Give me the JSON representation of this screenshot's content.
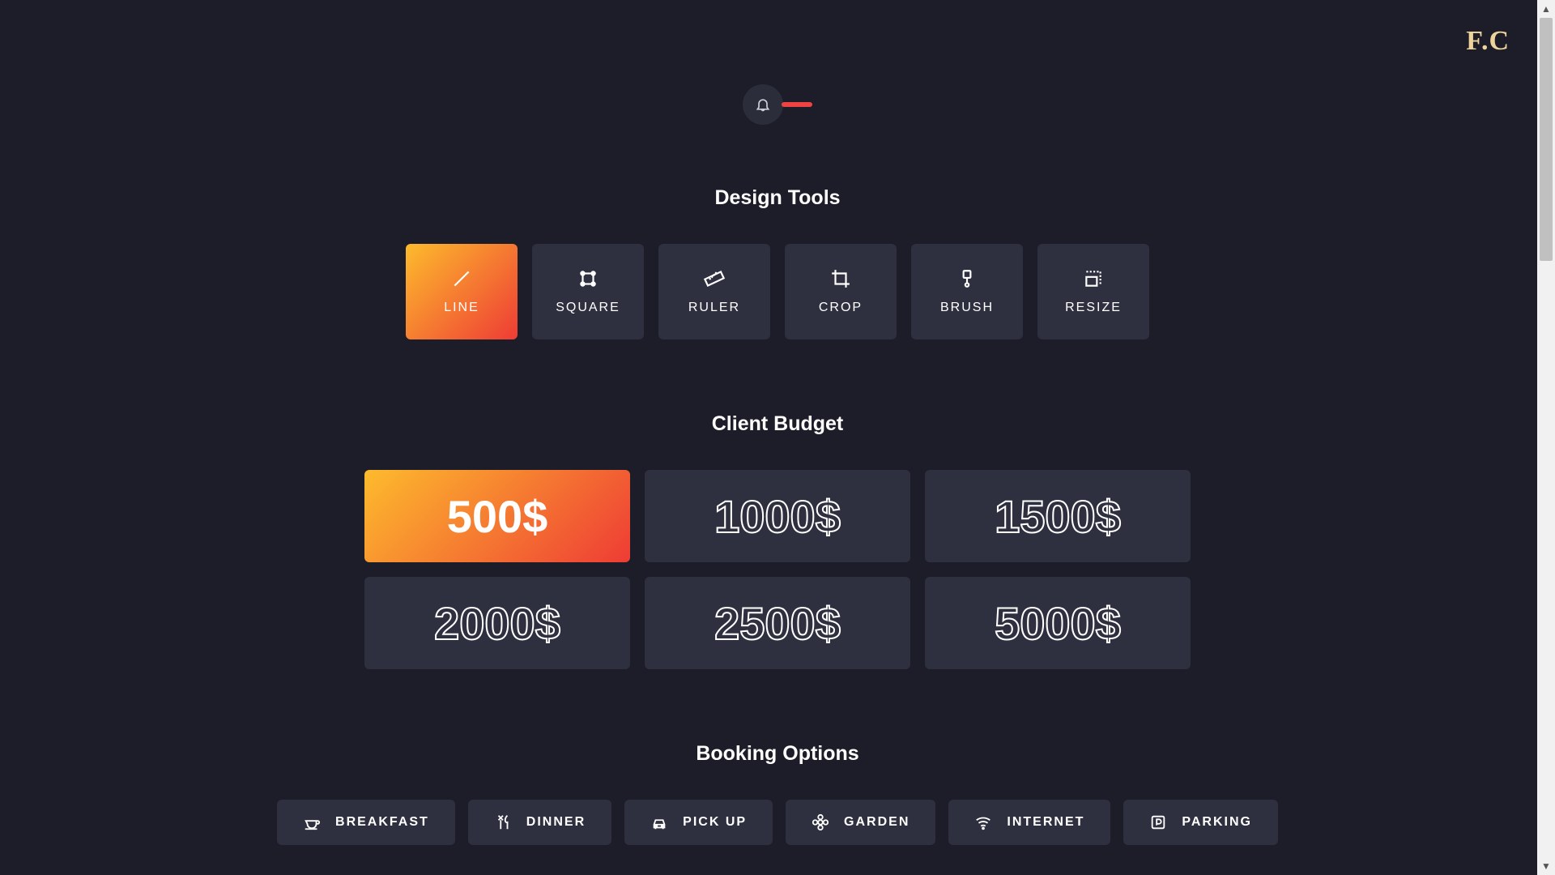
{
  "logo": "F.C",
  "sections": {
    "tools_title": "Design Tools",
    "budget_title": "Client Budget",
    "booking_title": "Booking Options"
  },
  "tools": [
    {
      "label": "LINE",
      "icon": "line-icon",
      "active": true
    },
    {
      "label": "SQUARE",
      "icon": "square-icon",
      "active": false
    },
    {
      "label": "RULER",
      "icon": "ruler-icon",
      "active": false
    },
    {
      "label": "CROP",
      "icon": "crop-icon",
      "active": false
    },
    {
      "label": "BRUSH",
      "icon": "brush-icon",
      "active": false
    },
    {
      "label": "RESIZE",
      "icon": "resize-icon",
      "active": false
    }
  ],
  "budgets": [
    {
      "label": "500$",
      "active": true
    },
    {
      "label": "1000$",
      "active": false
    },
    {
      "label": "1500$",
      "active": false
    },
    {
      "label": "2000$",
      "active": false
    },
    {
      "label": "2500$",
      "active": false
    },
    {
      "label": "5000$",
      "active": false
    }
  ],
  "booking": [
    {
      "label": "BREAKFAST",
      "icon": "coffee-icon"
    },
    {
      "label": "DINNER",
      "icon": "utensils-icon"
    },
    {
      "label": "PICK UP",
      "icon": "car-icon"
    },
    {
      "label": "GARDEN",
      "icon": "flower-icon"
    },
    {
      "label": "INTERNET",
      "icon": "wifi-icon"
    },
    {
      "label": "PARKING",
      "icon": "parking-icon"
    }
  ]
}
